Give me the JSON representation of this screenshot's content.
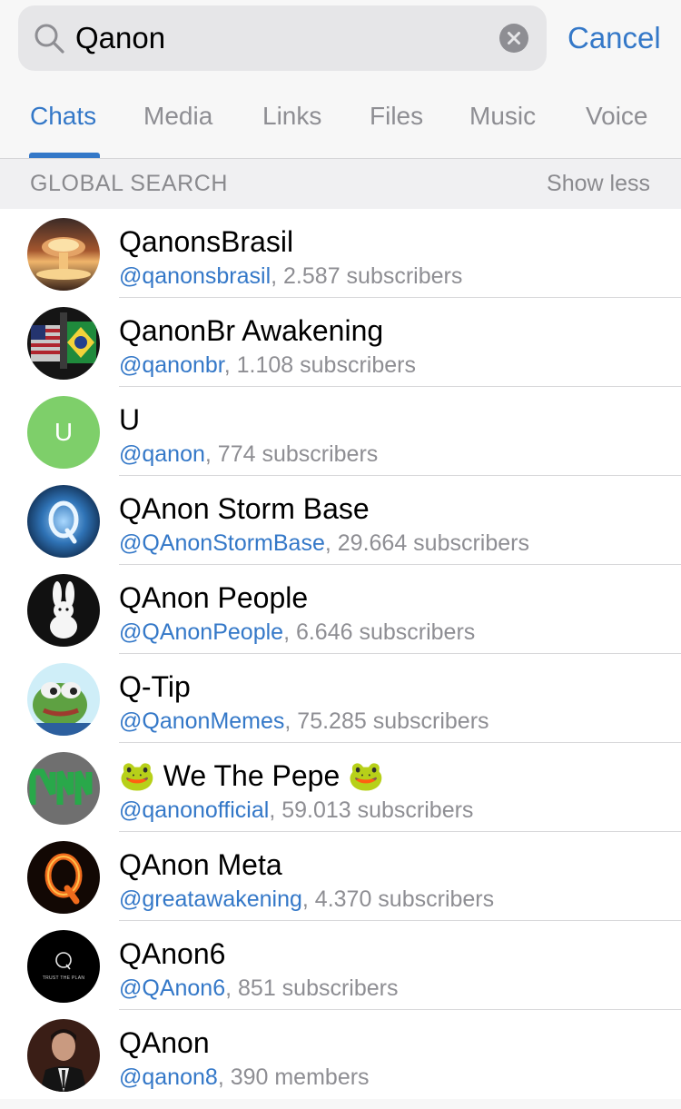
{
  "search": {
    "query": "Qanon",
    "cancel_label": "Cancel"
  },
  "tabs": [
    {
      "label": "Chats",
      "active": true
    },
    {
      "label": "Media",
      "active": false
    },
    {
      "label": "Links",
      "active": false
    },
    {
      "label": "Files",
      "active": false
    },
    {
      "label": "Music",
      "active": false
    },
    {
      "label": "Voice",
      "active": false
    }
  ],
  "section": {
    "title": "GLOBAL SEARCH",
    "action": "Show less"
  },
  "results": [
    {
      "title": "QanonsBrasil",
      "handle": "@qanonsbrasil",
      "meta": ", 2.587 subscribers",
      "avatar": "mushroom-cloud-icon"
    },
    {
      "title": "QanonBr Awakening",
      "handle": "@qanonbr",
      "meta": ", 1.108 subscribers",
      "avatar": "flags-figure-icon"
    },
    {
      "title": "U",
      "handle": "@qanon",
      "meta": ", 774 subscribers",
      "avatar_letter": "U",
      "avatar_color": "#7ecf6a"
    },
    {
      "title": "QAnon Storm Base",
      "handle": "@QAnonStormBase",
      "meta": ", 29.664 subscribers",
      "avatar": "storm-q-icon"
    },
    {
      "title": "QAnon People",
      "handle": "@QAnonPeople",
      "meta": ", 6.646 subscribers",
      "avatar": "white-rabbit-icon"
    },
    {
      "title": "Q-Tip",
      "handle": "@QanonMemes",
      "meta": ", 75.285 subscribers",
      "avatar": "frog-cartoon-icon"
    },
    {
      "title": "🐸 We The Pepe 🐸",
      "handle": "@qanonofficial",
      "meta": ", 59.013 subscribers",
      "avatar": "qn-logo-icon"
    },
    {
      "title": "QAnon Meta",
      "handle": "@greatawakening",
      "meta": ", 4.370 subscribers",
      "avatar": "fire-q-icon"
    },
    {
      "title": "QAnon6",
      "handle": "@QAnon6",
      "meta": ", 851 subscribers",
      "avatar": "trust-the-plan-icon",
      "avatar_text": "TRUST THE PLAN"
    },
    {
      "title": "QAnon",
      "handle": "@qanon8",
      "meta": ", 390 members",
      "avatar": "man-portrait-icon"
    }
  ],
  "colors": {
    "accent": "#3478c8",
    "secondary_text": "#8e8e93"
  }
}
